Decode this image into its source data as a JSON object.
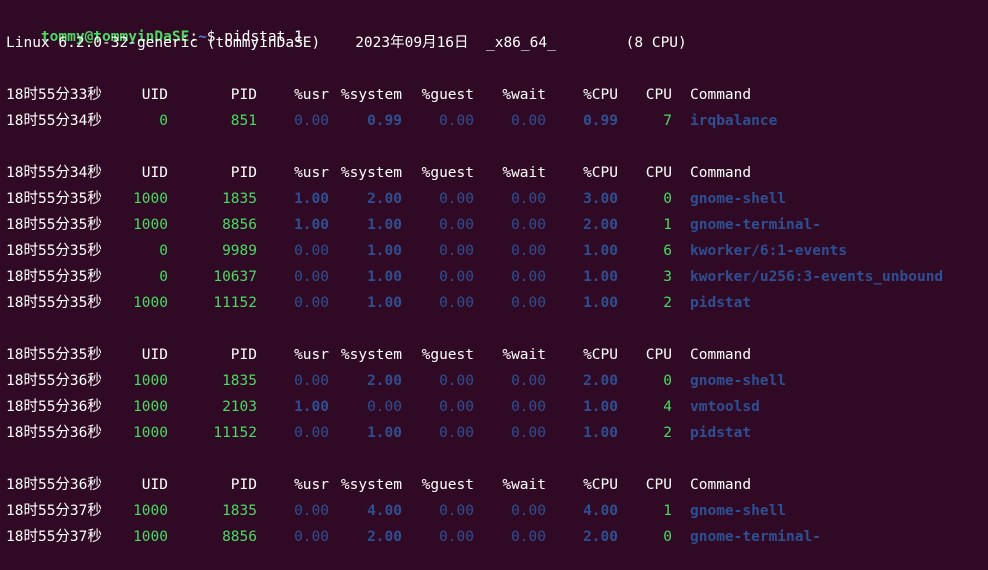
{
  "prompt": {
    "user_host": "tommy@tommyinDaSE",
    "colon": ":",
    "path": "~",
    "command": "$ pidstat 1"
  },
  "sysinfo": "Linux 6.2.0-32-generic (tommyinDaSE)    2023年09月16日  _x86_64_        (8 CPU)",
  "header_labels": [
    "UID",
    "PID",
    "%usr",
    "%system",
    "%guest",
    "%wait",
    "%CPU",
    "CPU",
    "Command"
  ],
  "blocks": [
    {
      "header_time": "18时55分33秒",
      "rows": [
        {
          "time": "18时55分34秒",
          "uid": "0",
          "pid": "851",
          "usr": "0.00",
          "system": "0.99",
          "guest": "0.00",
          "wait": "0.00",
          "cpu_pct": "0.99",
          "cpu": "7",
          "command": "irqbalance"
        }
      ]
    },
    {
      "header_time": "18时55分34秒",
      "rows": [
        {
          "time": "18时55分35秒",
          "uid": "1000",
          "pid": "1835",
          "usr": "1.00",
          "system": "2.00",
          "guest": "0.00",
          "wait": "0.00",
          "cpu_pct": "3.00",
          "cpu": "0",
          "command": "gnome-shell"
        },
        {
          "time": "18时55分35秒",
          "uid": "1000",
          "pid": "8856",
          "usr": "1.00",
          "system": "1.00",
          "guest": "0.00",
          "wait": "0.00",
          "cpu_pct": "2.00",
          "cpu": "1",
          "command": "gnome-terminal-"
        },
        {
          "time": "18时55分35秒",
          "uid": "0",
          "pid": "9989",
          "usr": "0.00",
          "system": "1.00",
          "guest": "0.00",
          "wait": "0.00",
          "cpu_pct": "1.00",
          "cpu": "6",
          "command": "kworker/6:1-events"
        },
        {
          "time": "18时55分35秒",
          "uid": "0",
          "pid": "10637",
          "usr": "0.00",
          "system": "1.00",
          "guest": "0.00",
          "wait": "0.00",
          "cpu_pct": "1.00",
          "cpu": "3",
          "command": "kworker/u256:3-events_unbound"
        },
        {
          "time": "18时55分35秒",
          "uid": "1000",
          "pid": "11152",
          "usr": "0.00",
          "system": "1.00",
          "guest": "0.00",
          "wait": "0.00",
          "cpu_pct": "1.00",
          "cpu": "2",
          "command": "pidstat"
        }
      ]
    },
    {
      "header_time": "18时55分35秒",
      "rows": [
        {
          "time": "18时55分36秒",
          "uid": "1000",
          "pid": "1835",
          "usr": "0.00",
          "system": "2.00",
          "guest": "0.00",
          "wait": "0.00",
          "cpu_pct": "2.00",
          "cpu": "0",
          "command": "gnome-shell"
        },
        {
          "time": "18时55分36秒",
          "uid": "1000",
          "pid": "2103",
          "usr": "1.00",
          "system": "0.00",
          "guest": "0.00",
          "wait": "0.00",
          "cpu_pct": "1.00",
          "cpu": "4",
          "command": "vmtoolsd"
        },
        {
          "time": "18时55分36秒",
          "uid": "1000",
          "pid": "11152",
          "usr": "0.00",
          "system": "1.00",
          "guest": "0.00",
          "wait": "0.00",
          "cpu_pct": "1.00",
          "cpu": "2",
          "command": "pidstat"
        }
      ]
    },
    {
      "header_time": "18时55分36秒",
      "rows": [
        {
          "time": "18时55分37秒",
          "uid": "1000",
          "pid": "1835",
          "usr": "0.00",
          "system": "4.00",
          "guest": "0.00",
          "wait": "0.00",
          "cpu_pct": "4.00",
          "cpu": "1",
          "command": "gnome-shell"
        },
        {
          "time": "18时55分37秒",
          "uid": "1000",
          "pid": "8856",
          "usr": "0.00",
          "system": "2.00",
          "guest": "0.00",
          "wait": "0.00",
          "cpu_pct": "2.00",
          "cpu": "0",
          "command": "gnome-terminal-"
        }
      ]
    }
  ]
}
